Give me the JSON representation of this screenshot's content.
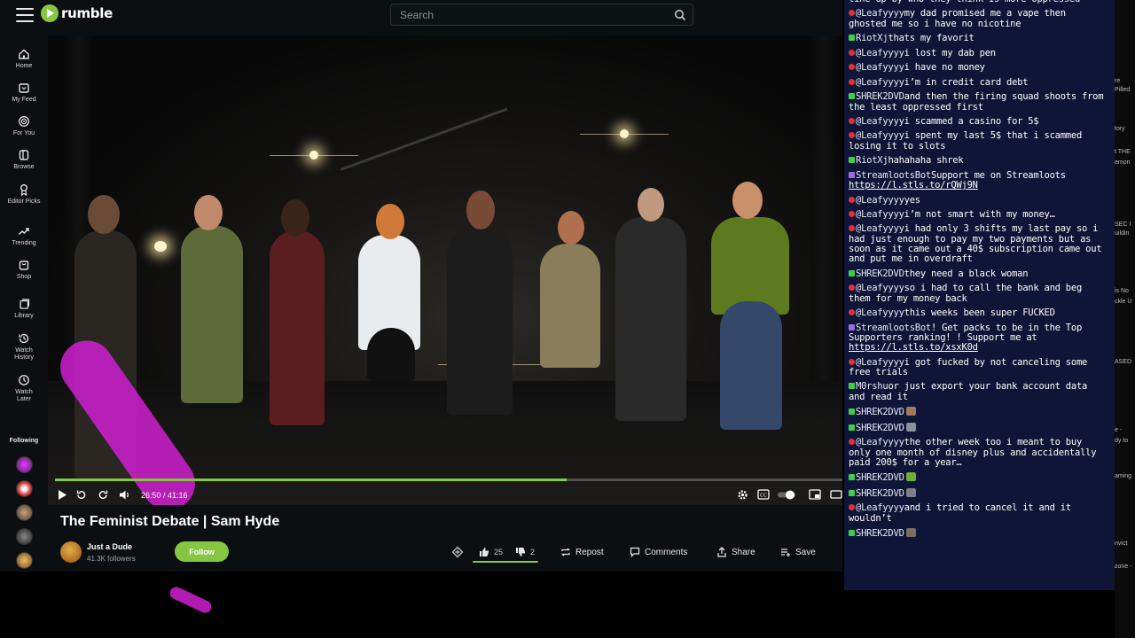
{
  "header": {
    "logo_text": "rumble",
    "search_placeholder": "Search"
  },
  "sidebar": {
    "items": [
      {
        "label": "Home",
        "icon": "home-icon"
      },
      {
        "label": "My Feed",
        "icon": "feed-icon"
      },
      {
        "label": "For You",
        "icon": "target-icon"
      },
      {
        "label": "Browse",
        "icon": "browse-icon"
      },
      {
        "label": "Editor Picks",
        "icon": "ribbon-icon"
      },
      {
        "label": "Trending",
        "icon": "trending-icon"
      },
      {
        "label": "Shop",
        "icon": "shop-icon"
      },
      {
        "label": "Library",
        "icon": "library-icon"
      },
      {
        "label": "Watch History",
        "icon": "history-icon"
      },
      {
        "label": "Watch Later",
        "icon": "clock-icon"
      }
    ],
    "following_label": "Following"
  },
  "player": {
    "time": "26:50 / 41:16",
    "progress": 0.65,
    "buffered": 1.0
  },
  "video": {
    "title": "The Feminist Debate | Sam Hyde",
    "channel_name": "Just a Dude",
    "channel_followers": "41.3K followers",
    "follow_label": "Follow",
    "likes": "25",
    "dislikes": "2",
    "repost_label": "Repost",
    "comments_label": "Comments",
    "share_label": "Share",
    "save_label": "Save"
  },
  "chat": {
    "messages": [
      {
        "badge": "none",
        "user": "",
        "text": "line up by who they think is more oppressed"
      },
      {
        "badge": "red",
        "user": "@Leafyyyy",
        "text": "my dad promised me a vape then ghosted me so i have no nicotine"
      },
      {
        "badge": "green",
        "user": "RiotXj",
        "text": "thats my favorit"
      },
      {
        "badge": "red",
        "user": "@Leafyyyy",
        "text": "i lost my dab pen"
      },
      {
        "badge": "red",
        "user": "@Leafyyyy",
        "text": "i have no money"
      },
      {
        "badge": "red",
        "user": "@Leafyyyy",
        "text": "i’m in credit card debt"
      },
      {
        "badge": "green",
        "user": "SHREK2DVD",
        "text": "and then the firing squad shoots from the least oppressed first"
      },
      {
        "badge": "red",
        "user": "@Leafyyyy",
        "text": "i scammed a casino for 5$"
      },
      {
        "badge": "red",
        "user": "@Leafyyyy",
        "text": "i spent my last 5$ that i scammed losing it to slots"
      },
      {
        "badge": "green",
        "user": "RiotXj",
        "text": "hahahaha shrek"
      },
      {
        "badge": "purple",
        "user": "StreamlootsBot",
        "text": "Support me on Streamloots ",
        "link": "https://l.stls.to/rQWj9N"
      },
      {
        "badge": "red",
        "user": "@Leafyyyy",
        "text": "yes"
      },
      {
        "badge": "red",
        "user": "@Leafyyyy",
        "text": "i’m not smart with my money…"
      },
      {
        "badge": "red",
        "user": "@Leafyyyy",
        "text": "i had only 3 shifts my last pay so i had just enough to pay my two payments but as soon as it came out a 40$ subscription came out and put me in overdraft"
      },
      {
        "badge": "green",
        "user": "SHREK2DVD",
        "text": "they need a black woman"
      },
      {
        "badge": "red",
        "user": "@Leafyyyy",
        "text": "so i had to call the bank and beg them for my money back"
      },
      {
        "badge": "red",
        "user": "@Leafyyyy",
        "text": "this weeks been super FUCKED"
      },
      {
        "badge": "purple",
        "user": "StreamlootsBot",
        "text": "! Get packs to be in the Top Supporters ranking! ! Support me at ",
        "link": "https://l.stls.to/xsxK0d"
      },
      {
        "badge": "red",
        "user": "@Leafyyyy",
        "text": "i got fucked by not canceling some free trials"
      },
      {
        "badge": "green",
        "user": "M0rshu",
        "text": "or just export your bank account data and read it"
      },
      {
        "badge": "green",
        "user": "SHREK2DVD",
        "text": "",
        "emote": "#a0785a"
      },
      {
        "badge": "green",
        "user": "SHREK2DVD",
        "text": "",
        "emote": "#8a8f9a"
      },
      {
        "badge": "red",
        "user": "@Leafyyyy",
        "text": "the other week too i meant to buy only one month of disney plus and accidentally paid 200$ for a year…"
      },
      {
        "badge": "green",
        "user": "SHREK2DVD",
        "text": "",
        "emote": "#6fae3a"
      },
      {
        "badge": "green",
        "user": "SHREK2DVD",
        "text": "",
        "emote": "#7d7f86"
      },
      {
        "badge": "red",
        "user": "@Leafyyyy",
        "text": "and i tried to cancel it and it wouldn’t"
      },
      {
        "badge": "green",
        "user": "SHREK2DVD",
        "text": "",
        "emote": "#7a6e62"
      }
    ]
  },
  "right_strip": [
    "re",
    "Pilled",
    "tory",
    "t THE",
    "emon",
    "SEC I",
    "uildin",
    "is No",
    "ckle U",
    "ASED",
    "e -",
    "dy to",
    "aming",
    "nvict",
    "zone -"
  ],
  "colors": {
    "accent": "#85c742",
    "chat_bg": "#0e1536",
    "badge_red": "#e0303a",
    "badge_green": "#3fcf4a",
    "badge_purple": "#9b6be0"
  }
}
